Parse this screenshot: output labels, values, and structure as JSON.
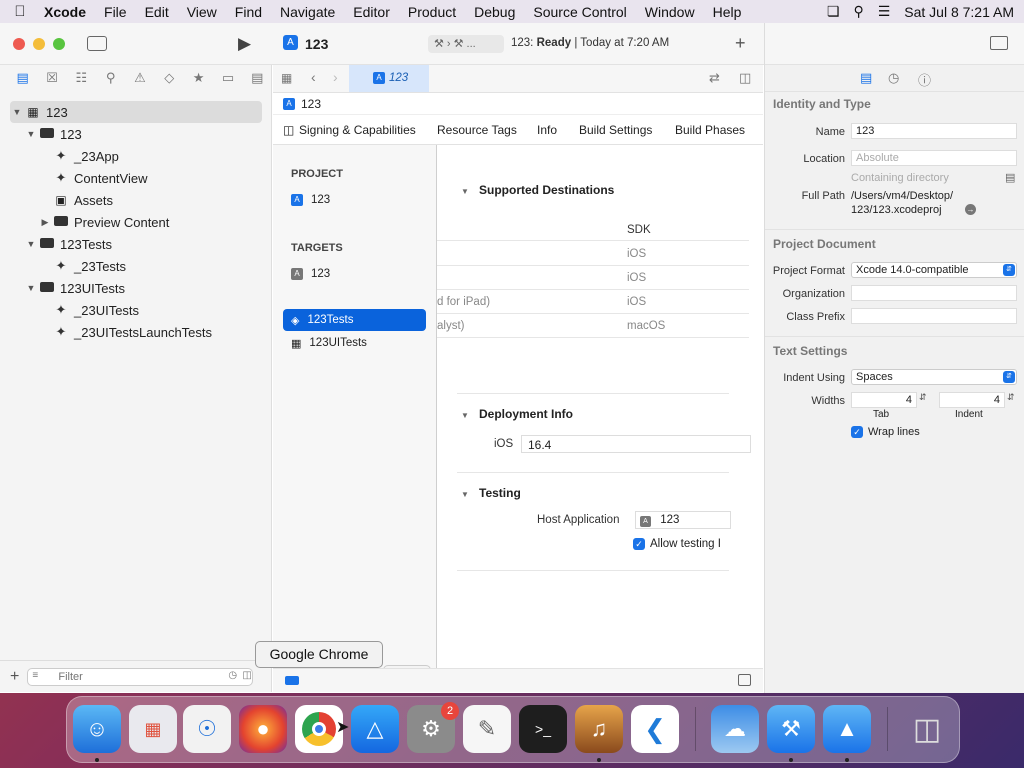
{
  "menubar": {
    "app": "Xcode",
    "items": [
      "File",
      "Edit",
      "View",
      "Find",
      "Navigate",
      "Editor",
      "Product",
      "Debug",
      "Source Control",
      "Window",
      "Help"
    ],
    "clock": "Sat Jul 8  7:21 AM"
  },
  "toolbar": {
    "project": "123",
    "status_scheme": "123:",
    "status_state": "Ready",
    "status_time": "| Today at 7:20 AM"
  },
  "tab": {
    "label": "123"
  },
  "jumpbar": {
    "label": "123"
  },
  "navigator": {
    "filter_placeholder": "Filter",
    "rows": [
      {
        "label": "123"
      },
      {
        "label": "123"
      },
      {
        "label": "_23App"
      },
      {
        "label": "ContentView"
      },
      {
        "label": "Assets"
      },
      {
        "label": "Preview Content"
      },
      {
        "label": "123Tests"
      },
      {
        "label": "_23Tests"
      },
      {
        "label": "123UITests"
      },
      {
        "label": "_23UITests"
      },
      {
        "label": "_23UITestsLaunchTests"
      }
    ]
  },
  "editor_tabs": [
    "Signing & Capabilities",
    "Resource Tags",
    "Info",
    "Build Settings",
    "Build Phases"
  ],
  "targets_panel": {
    "project_header": "PROJECT",
    "project_item": "123",
    "targets_header": "TARGETS",
    "targets": [
      "123",
      "123Tests",
      "123UITests"
    ]
  },
  "content": {
    "supported_destinations": "Supported Destinations",
    "sdk_header": "SDK",
    "dest_rows": [
      {
        "name": "",
        "sdk": "iOS"
      },
      {
        "name": "",
        "sdk": "iOS"
      },
      {
        "name": "d for iPad)",
        "sdk": "iOS"
      },
      {
        "name": "alyst)",
        "sdk": "macOS"
      }
    ],
    "deployment_info": "Deployment Info",
    "ios_label": "iOS",
    "ios_version": "16.4",
    "testing": "Testing",
    "host_app_label": "Host Application",
    "host_app_value": "123",
    "allow_testing": "Allow testing I"
  },
  "inspector": {
    "identity_header": "Identity and Type",
    "name_label": "Name",
    "name_value": "123",
    "location_label": "Location",
    "location_value": "Absolute",
    "containing": "Containing directory",
    "fullpath_label": "Full Path",
    "fullpath_line1": "/Users/vm4/Desktop/",
    "fullpath_line2": "123/123.xcodeproj",
    "project_doc_header": "Project Document",
    "format_label": "Project Format",
    "format_value": "Xcode 14.0-compatible",
    "org_label": "Organization",
    "prefix_label": "Class Prefix",
    "text_settings_header": "Text Settings",
    "indent_label": "Indent Using",
    "indent_value": "Spaces",
    "widths_label": "Widths",
    "tab_width": "4",
    "indent_width": "4",
    "tab_caption": "Tab",
    "indent_caption": "Indent",
    "wrap_label": "Wrap lines"
  },
  "tooltip": "Google Chrome",
  "dock": {
    "settings_badge": "2"
  }
}
